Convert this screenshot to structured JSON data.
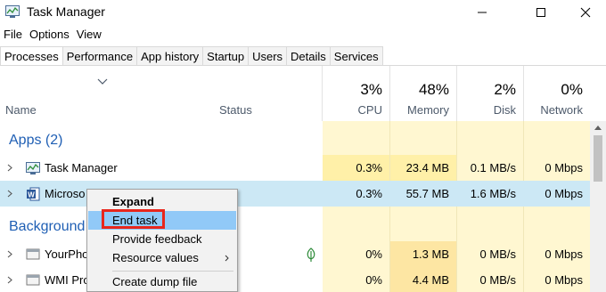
{
  "window": {
    "title": "Task Manager"
  },
  "menu": [
    "File",
    "Options",
    "View"
  ],
  "tabs": [
    "Processes",
    "Performance",
    "App history",
    "Startup",
    "Users",
    "Details",
    "Services"
  ],
  "header": {
    "name": "Name",
    "status": "Status",
    "cpu": {
      "pct": "3%",
      "label": "CPU"
    },
    "memory": {
      "pct": "48%",
      "label": "Memory"
    },
    "disk": {
      "pct": "2%",
      "label": "Disk"
    },
    "network": {
      "pct": "0%",
      "label": "Network"
    }
  },
  "groups": {
    "apps": "Apps (2)",
    "background": "Background"
  },
  "rows": [
    {
      "name": "Task Manager",
      "cpu": "0.3%",
      "memory": "23.4 MB",
      "disk": "0.1 MB/s",
      "network": "0 Mbps"
    },
    {
      "name": "Microso",
      "cpu": "0.3%",
      "memory": "55.7 MB",
      "disk": "1.6 MB/s",
      "network": "0 Mbps"
    },
    {
      "name": "YourPho",
      "cpu": "0%",
      "memory": "1.3 MB",
      "disk": "0 MB/s",
      "network": "0 Mbps"
    },
    {
      "name": "WMI Pro",
      "cpu": "0%",
      "memory": "4.4 MB",
      "disk": "0 MB/s",
      "network": "0 Mbps"
    }
  ],
  "context_menu": [
    "Expand",
    "End task",
    "Provide feedback",
    "Resource values",
    "Create dump file"
  ],
  "colors": {
    "accent": "#1f5fb4",
    "highlight_box": "#e8261c",
    "column_bg": "#fff7d1",
    "selected_row": "#cce8f5",
    "menu_hover": "#91c9f7"
  },
  "icons": [
    "task-manager-icon",
    "minimize-icon",
    "maximize-icon",
    "close-icon",
    "chevron-down-icon",
    "chevron-right-icon",
    "word-icon",
    "leaf-icon",
    "submenu-arrow-icon"
  ]
}
